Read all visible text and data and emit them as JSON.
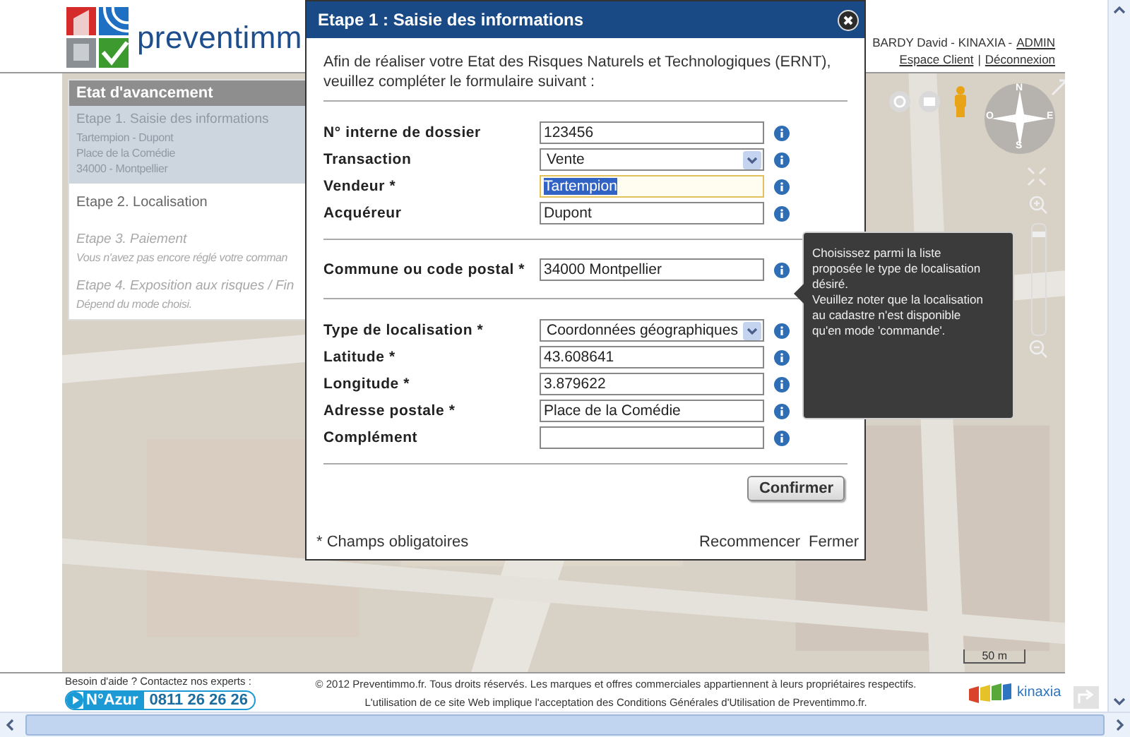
{
  "header": {
    "logo_text": "preventimm",
    "user_name": "BARDY David - KINAXIA -",
    "admin_link": "ADMIN",
    "links": [
      "Espace Client",
      "Déconnexion"
    ],
    "link_separator": "|"
  },
  "progress": {
    "title": "Etat d'avancement",
    "steps": [
      {
        "title": "Etape 1. Saisie des informations",
        "details": [
          "Tartempion - Dupont",
          "Place de la Comédie",
          "34000 - Montpellier"
        ],
        "kind": "done"
      },
      {
        "title": "Etape 2. Localisation",
        "kind": "current"
      },
      {
        "title": "Etape 3. Paiement",
        "details": [
          "Vous n'avez pas encore réglé votre comman"
        ],
        "kind": "pending"
      },
      {
        "title": "Etape 4. Exposition aux risques / Fin",
        "details": [
          "Dépend du mode choisi."
        ],
        "kind": "pending"
      }
    ]
  },
  "map_controls": {
    "compass_letters": [
      "N",
      "O",
      "E",
      "S"
    ],
    "zoom": {
      "level": 0.93
    },
    "scale": "50 m"
  },
  "modal": {
    "title": "Etape 1 : Saisie des informations",
    "intro": "Afin de réaliser votre Etat des Risques Naturels et Technologiques (ERNT), veuillez compléter le formulaire suivant :",
    "sections": [
      {
        "fields": [
          {
            "label": "N° interne de dossier",
            "kind": "text",
            "value": "123456",
            "focused": false
          },
          {
            "label": "Transaction",
            "kind": "select",
            "value": "Vente"
          },
          {
            "label": "Vendeur *",
            "kind": "text",
            "value": "Tartempion",
            "focused": true
          },
          {
            "label": "Acquéreur",
            "kind": "text",
            "value": "Dupont",
            "focused": false
          }
        ]
      },
      {
        "fields": [
          {
            "label": "Commune ou code postal *",
            "kind": "text",
            "value": "34000 Montpellier",
            "focused": false
          }
        ]
      },
      {
        "fields": [
          {
            "label": "Type de localisation *",
            "kind": "select",
            "value": "Coordonnées géographiques"
          },
          {
            "label": "Latitude *",
            "kind": "text",
            "value": "43.608641",
            "focused": false
          },
          {
            "label": "Longitude *",
            "kind": "text",
            "value": "3.879622",
            "focused": false
          },
          {
            "label": "Adresse postale *",
            "kind": "text",
            "value": "Place de la Comédie",
            "focused": false
          },
          {
            "label": "Complément",
            "kind": "text",
            "focused": false
          }
        ]
      }
    ],
    "confirm_button": "Confirmer",
    "footnote": "* Champs obligatoires",
    "links": [
      "Recommencer",
      "Fermer"
    ]
  },
  "tooltip": {
    "text": "Choisissez parmi la liste\nproposée le type de localisation\ndésiré.\nVeuillez noter que la localisation\nau cadastre n'est disponible\nqu'en mode 'commande'."
  },
  "footer": {
    "help": "Besoin d'aide ? Contactez nos experts :",
    "azur_label": "N°Azur",
    "phone": "0811 26 26 26",
    "copyright": "© 2012 Preventimmo.fr. Tous droits réservés. Les marques et offres commerciales appartiennent à leurs propriétaires respectifs.",
    "terms": "L'utilisation de ce site Web implique l'acceptation des Conditions Générales d'Utilisation de Preventimmo.fr.",
    "partner_logo": "kinaxia"
  }
}
